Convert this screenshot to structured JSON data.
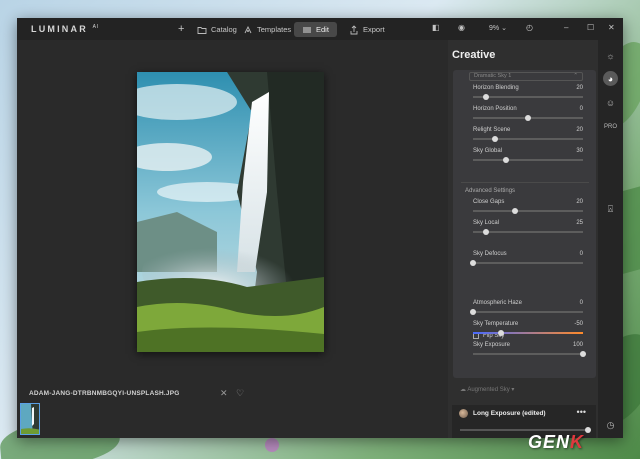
{
  "app": {
    "logo": "LUMINAR",
    "logo_suffix": "AI"
  },
  "toolbar": {
    "add_label": "+",
    "catalog_label": "Catalog",
    "templates_label": "Templates",
    "edit_label": "Edit",
    "export_label": "Export",
    "zoom_label": "9%"
  },
  "image": {
    "filename": "ADAM-JANG-DTRBNMBGQYI-UNSPLASH.JPG"
  },
  "panel": {
    "title": "Creative",
    "sky_dropdown": "Dramatic Sky 1",
    "sliders_top": [
      {
        "label": "Horizon Blending",
        "value": "20",
        "fraction": 0.12
      },
      {
        "label": "Horizon Position",
        "value": "0",
        "fraction": 0.5
      },
      {
        "label": "Relight Scene",
        "value": "20",
        "fraction": 0.2
      },
      {
        "label": "Sky Global",
        "value": "30",
        "fraction": 0.3
      }
    ],
    "advanced_label": "Advanced Settings",
    "sliders_adv": [
      {
        "label": "Close Gaps",
        "value": "20",
        "fraction": 0.38
      },
      {
        "label": "Sky Local",
        "value": "25",
        "fraction": 0.12
      },
      {
        "label": "Sky Defocus",
        "value": "0",
        "fraction": 0.0
      }
    ],
    "flip_sky_label": "Flip Sky",
    "sliders_bottom": [
      {
        "label": "Atmospheric Haze",
        "value": "0",
        "fraction": 0.0
      },
      {
        "label": "Sky Temperature",
        "value": "-50",
        "fraction": 0.25
      },
      {
        "label": "Sky Exposure",
        "value": "100",
        "fraction": 1.0
      }
    ],
    "augmented_label": "Augmented Sky ▾",
    "layer_name": "Long Exposure (edited)",
    "layer_menu": "•••",
    "layer_fraction": 1.0
  },
  "colors": {
    "accent": "#5aa0e6",
    "temperature_gradient": [
      "#4a6bff",
      "#ff8a2a"
    ]
  },
  "watermark": {
    "main": "GEN",
    "accent": "K"
  }
}
